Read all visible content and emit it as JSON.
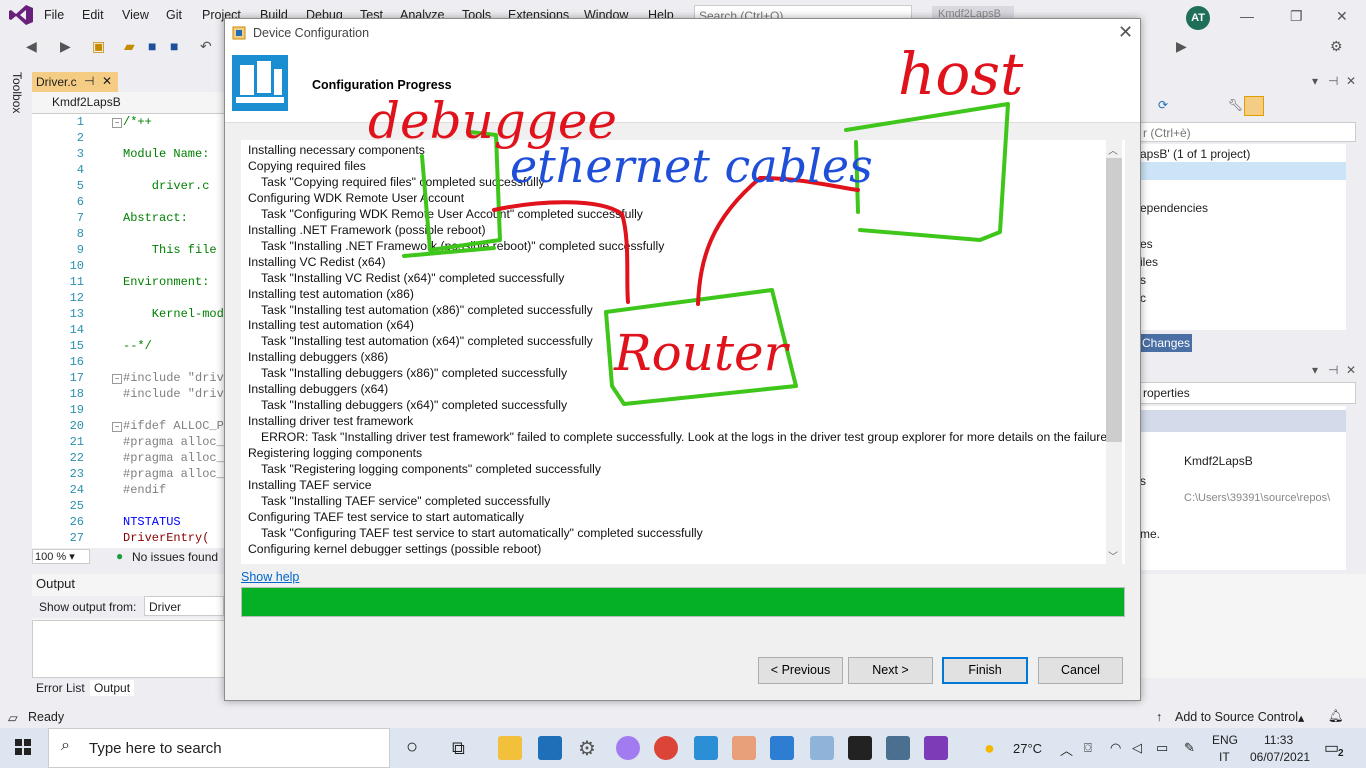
{
  "vs": {
    "menu": [
      "File",
      "Edit",
      "View",
      "Git",
      "Project",
      "Build",
      "Debug",
      "Test",
      "Analyze",
      "Tools",
      "Extensions",
      "Window",
      "Help"
    ],
    "search_placeholder": "Search (Ctrl+Q)",
    "solution_name": "Kmdf2LapsB",
    "user_initials": "AT",
    "toolbox_label": "Toolbox",
    "editor_tab": "Driver.c",
    "nav_project": "Kmdf2LapsB",
    "code_lines": [
      {
        "n": "1",
        "t": "/*++"
      },
      {
        "n": "2",
        "t": ""
      },
      {
        "n": "3",
        "t": "Module Name:"
      },
      {
        "n": "4",
        "t": ""
      },
      {
        "n": "5",
        "t": "    driver.c"
      },
      {
        "n": "6",
        "t": ""
      },
      {
        "n": "7",
        "t": "Abstract:"
      },
      {
        "n": "8",
        "t": ""
      },
      {
        "n": "9",
        "t": "    This file c"
      },
      {
        "n": "10",
        "t": ""
      },
      {
        "n": "11",
        "t": "Environment:"
      },
      {
        "n": "12",
        "t": ""
      },
      {
        "n": "13",
        "t": "    Kernel-mode"
      },
      {
        "n": "14",
        "t": ""
      },
      {
        "n": "15",
        "t": "--*/"
      },
      {
        "n": "16",
        "t": ""
      },
      {
        "n": "17",
        "t": "#include \"drive"
      },
      {
        "n": "18",
        "t": "#include \"drive"
      },
      {
        "n": "19",
        "t": ""
      },
      {
        "n": "20",
        "t": "#ifdef ALLOC_PR"
      },
      {
        "n": "21",
        "t": "#pragma alloc_t"
      },
      {
        "n": "22",
        "t": "#pragma alloc_t"
      },
      {
        "n": "23",
        "t": "#pragma alloc_t"
      },
      {
        "n": "24",
        "t": "#endif"
      },
      {
        "n": "25",
        "t": ""
      },
      {
        "n": "26",
        "t": "NTSTATUS"
      },
      {
        "n": "27",
        "t": "DriverEntry("
      }
    ],
    "zoom": "100 %",
    "issues": "No issues found",
    "output_title": "Output",
    "output_from_label": "Show output from:",
    "output_from_value": "Driver",
    "bottom_tabs": [
      "Error List",
      "Output"
    ],
    "solution_search": "r (Ctrl+è)",
    "solution_root": "apsB' (1 of 1 project)",
    "tree_items": [
      "ependencies",
      "es",
      "iles",
      "s",
      "c"
    ],
    "git_changes": "Changes",
    "props_select": "roperties",
    "props_value_1": "Kmdf2LapsB",
    "props_key_2": "s",
    "props_value_2": "C:\\Users\\39391\\source\\repos\\",
    "props_desc": "me.",
    "status_ready": "Ready",
    "status_source_control": "Add to Source Control"
  },
  "taskbar": {
    "search_placeholder": "Type here to search",
    "weather": "27°C",
    "lang_1": "ENG",
    "lang_2": "IT",
    "time": "11:33",
    "date": "06/07/2021",
    "notif_count": "2"
  },
  "dialog": {
    "title": "Device Configuration",
    "heading": "Configuration Progress",
    "log": [
      {
        "indent": false,
        "text": "Installing necessary components"
      },
      {
        "indent": false,
        "text": "Copying required files"
      },
      {
        "indent": true,
        "text": "Task \"Copying required files\" completed successfully"
      },
      {
        "indent": false,
        "text": "Configuring WDK Remote User Account"
      },
      {
        "indent": true,
        "text": "Task \"Configuring WDK Remote User Account\" completed successfully"
      },
      {
        "indent": false,
        "text": "Installing .NET Framework (possible reboot)"
      },
      {
        "indent": true,
        "text": "Task \"Installing .NET Framework (possible reboot)\" completed successfully"
      },
      {
        "indent": false,
        "text": "Installing VC Redist (x64)"
      },
      {
        "indent": true,
        "text": "Task \"Installing VC Redist (x64)\" completed successfully"
      },
      {
        "indent": false,
        "text": "Installing test automation (x86)"
      },
      {
        "indent": true,
        "text": "Task \"Installing test automation (x86)\" completed successfully"
      },
      {
        "indent": false,
        "text": "Installing test automation (x64)"
      },
      {
        "indent": true,
        "text": "Task \"Installing test automation (x64)\" completed successfully"
      },
      {
        "indent": false,
        "text": "Installing debuggers (x86)"
      },
      {
        "indent": true,
        "text": "Task \"Installing debuggers (x86)\" completed successfully"
      },
      {
        "indent": false,
        "text": "Installing debuggers (x64)"
      },
      {
        "indent": true,
        "text": "Task \"Installing debuggers (x64)\" completed successfully"
      },
      {
        "indent": false,
        "text": "Installing driver test framework"
      },
      {
        "indent": true,
        "text": "ERROR: Task \"Installing driver test framework\" failed to complete successfully. Look at the logs in the driver test group explorer for more details on the failure."
      },
      {
        "indent": false,
        "text": "Registering logging components"
      },
      {
        "indent": true,
        "text": "Task \"Registering logging components\" completed successfully"
      },
      {
        "indent": false,
        "text": "Installing TAEF service"
      },
      {
        "indent": true,
        "text": "Task \"Installing TAEF service\" completed successfully"
      },
      {
        "indent": false,
        "text": "Configuring TAEF test service to start automatically"
      },
      {
        "indent": true,
        "text": "Task \"Configuring TAEF test service to start automatically\" completed successfully"
      },
      {
        "indent": false,
        "text": "Configuring kernel debugger settings (possible reboot)"
      },
      {
        "indent": true,
        "text": "Task \"Configuring kernel debugger settings (possible reboot)\" completed successfully"
      }
    ],
    "show_help": "Show help",
    "progress_percent": 100,
    "progress_color": "#06b025",
    "buttons": {
      "previous": "< Previous",
      "next": "Next >",
      "finish": "Finish",
      "cancel": "Cancel"
    }
  },
  "annotations": {
    "debuggee": "debuggee",
    "ethernet": "ethernet cables",
    "host": "host",
    "router": "Router"
  }
}
